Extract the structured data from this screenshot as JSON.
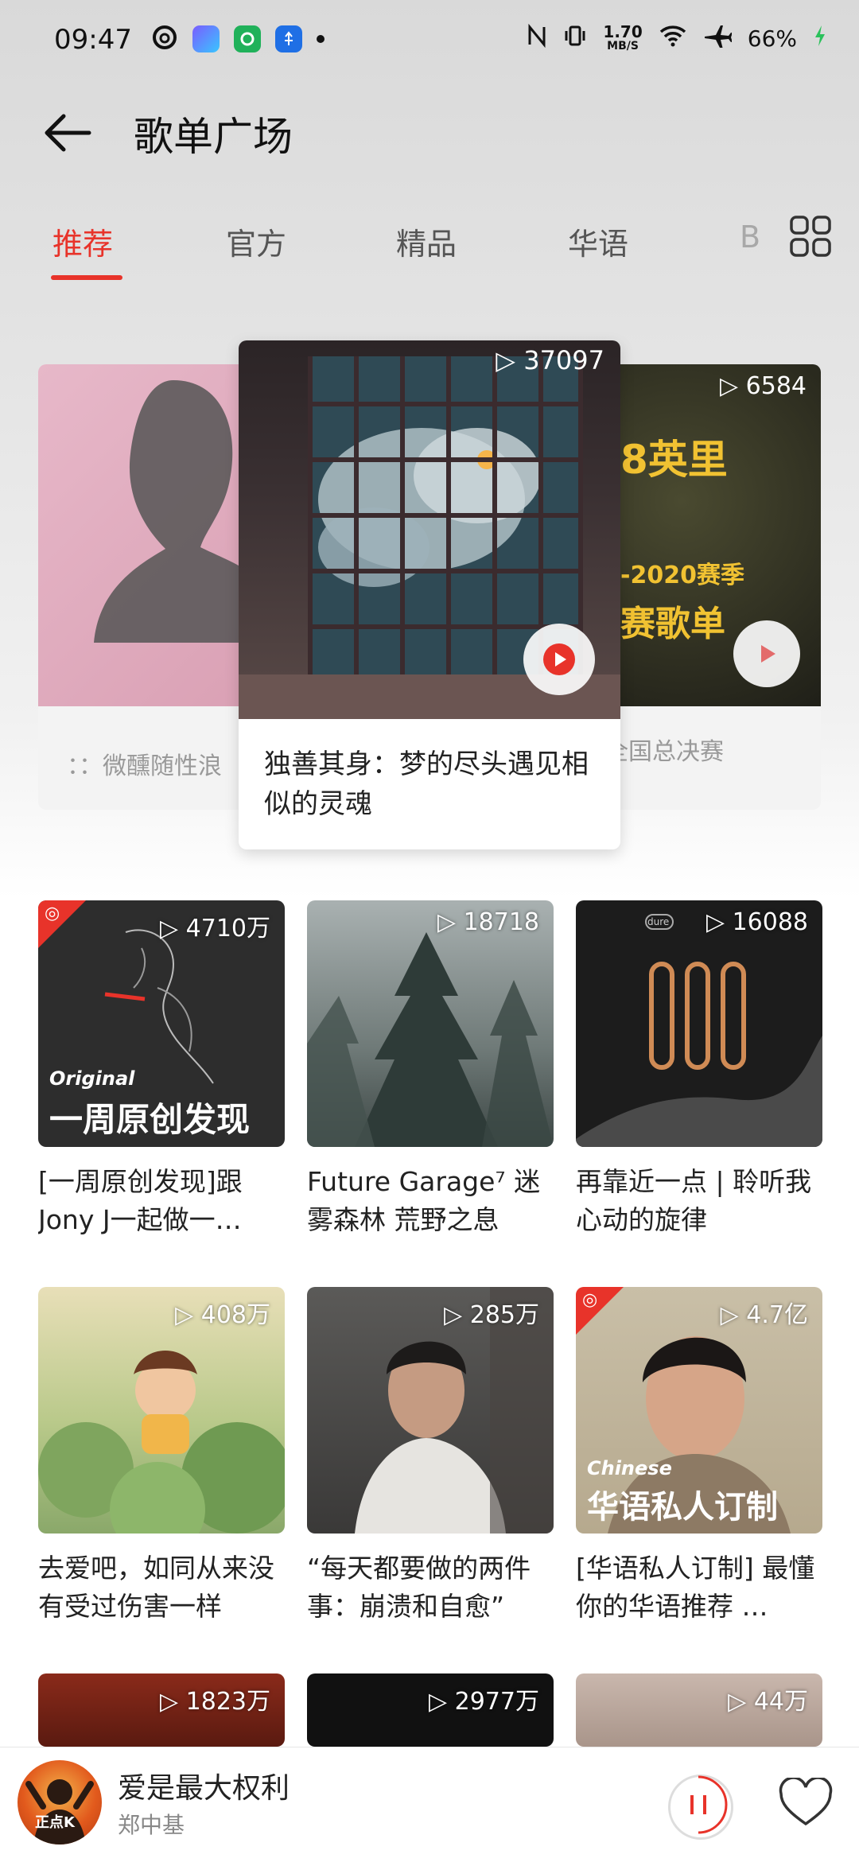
{
  "status_bar": {
    "time": "09:47",
    "net_speed_value": "1.70",
    "net_speed_unit": "MB/S",
    "battery": "66%",
    "icons": [
      "netease-icon",
      "ai-icon",
      "app-icon",
      "usb-icon",
      "dot-icon",
      "nfc-icon",
      "vibrate-icon",
      "wifi-icon",
      "airplane-icon",
      "charging-icon"
    ]
  },
  "header": {
    "title": "歌单广场"
  },
  "tabs": [
    {
      "label": "推荐",
      "active": true
    },
    {
      "label": "官方",
      "active": false
    },
    {
      "label": "精品",
      "active": false
    },
    {
      "label": "华语",
      "active": false
    },
    {
      "label": "B",
      "active": false
    }
  ],
  "carousel": {
    "left": {
      "caption": "：：微醺随性浪"
    },
    "center": {
      "plays": "37097",
      "caption": "独善其身：梦的尽头遇见相似的灵魂"
    },
    "right": {
      "plays": "6584",
      "caption": "全国总决赛",
      "cover_text_1": "8英里",
      "cover_text_2": "-2020赛季",
      "cover_text_3": "赛歌单"
    }
  },
  "playlists": [
    {
      "plays": "4710万",
      "title": "[一周原创发现]跟Jony J一起做一…",
      "cover_label_small": "Original",
      "cover_label_big": "一周原创发现",
      "badge": true
    },
    {
      "plays": "18718",
      "title": "Future Garage⁷ 迷雾森林 荒野之息"
    },
    {
      "plays": "16088",
      "title": "再靠近一点 | 聆听我心动的旋律",
      "cover_tag": "dure"
    },
    {
      "plays": "408万",
      "title": "去爱吧，如同从来没有受过伤害一样"
    },
    {
      "plays": "285万",
      "title": "“每天都要做的两件事：崩溃和自愈”"
    },
    {
      "plays": "4.7亿",
      "title": "[华语私人订制] 最懂你的华语推荐 …",
      "cover_label_small": "Chinese",
      "cover_label_big": "华语私人订制",
      "badge": true
    },
    {
      "plays": "1823万",
      "title": ""
    },
    {
      "plays": "2977万",
      "title": ""
    },
    {
      "plays": "44万",
      "title": ""
    }
  ],
  "player": {
    "song": "爱是最大权利",
    "artist": "郑中基",
    "avatar_text": "正点K"
  },
  "colors": {
    "accent": "#e8332a"
  }
}
